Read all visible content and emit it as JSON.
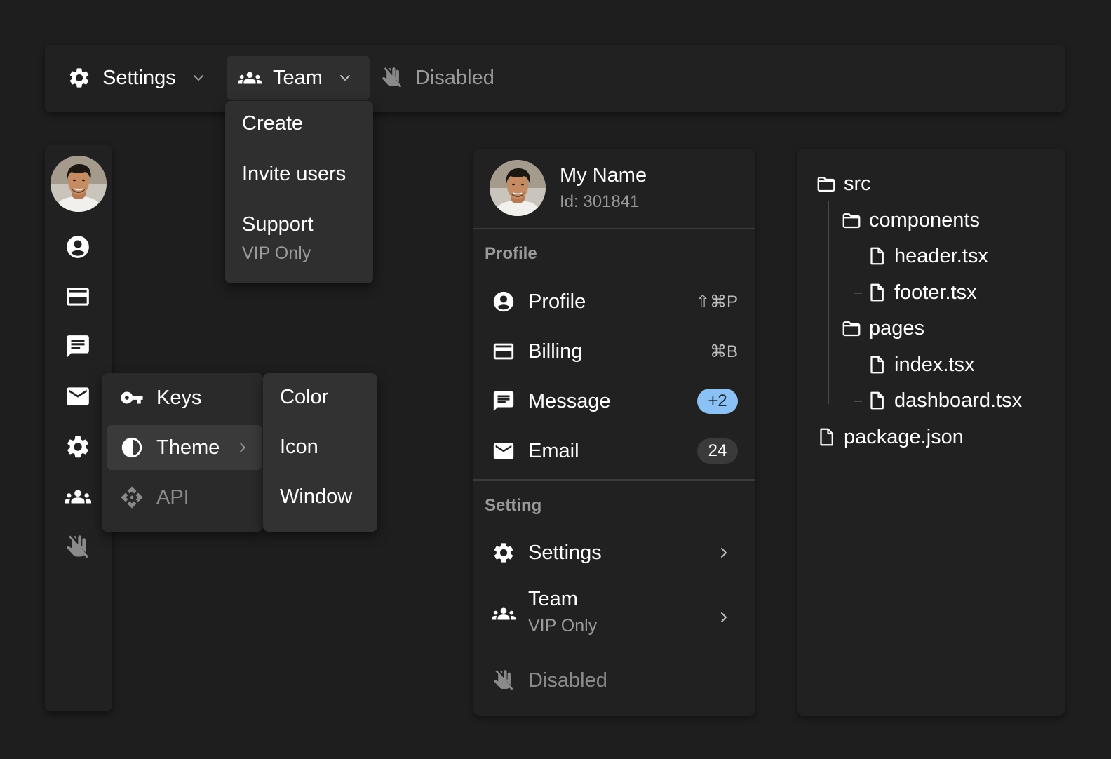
{
  "menubar": {
    "settings": {
      "label": "Settings",
      "icon": "gear-icon"
    },
    "team": {
      "label": "Team",
      "icon": "users-icon"
    },
    "disabled": {
      "label": "Disabled",
      "icon": "hand-icon"
    }
  },
  "team_dropdown": {
    "items": [
      {
        "label": "Create"
      },
      {
        "label": "Invite users"
      },
      {
        "label": "Support",
        "sub": "VIP Only"
      }
    ]
  },
  "rail": {
    "icons": [
      "user-circle-icon",
      "credit-card-icon",
      "message-icon",
      "mail-icon",
      "gear-icon",
      "users-icon",
      "hand-icon"
    ]
  },
  "flyout": {
    "items": [
      {
        "label": "Keys",
        "icon": "key-icon"
      },
      {
        "label": "Theme",
        "icon": "contrast-icon"
      },
      {
        "label": "API",
        "icon": "api-icon"
      }
    ]
  },
  "submenu": {
    "items": [
      {
        "label": "Color"
      },
      {
        "label": "Icon"
      },
      {
        "label": "Window"
      }
    ]
  },
  "profile_panel": {
    "name": "My Name",
    "id": "Id: 301841",
    "groups": [
      {
        "label": "Profile",
        "items": [
          {
            "label": "Profile",
            "shortcut": "⇧⌘P"
          },
          {
            "label": "Billing",
            "shortcut": "⌘B"
          },
          {
            "label": "Message",
            "badge": "+2"
          },
          {
            "label": "Email",
            "badge": "24"
          }
        ]
      },
      {
        "label": "Setting",
        "items": [
          {
            "label": "Settings"
          },
          {
            "label": "Team",
            "sub": "VIP Only"
          },
          {
            "label": "Disabled"
          }
        ]
      }
    ]
  },
  "file_tree": {
    "items": [
      {
        "label": "src",
        "type": "folder"
      },
      {
        "label": "components",
        "type": "folder"
      },
      {
        "label": "header.tsx",
        "type": "file"
      },
      {
        "label": "footer.tsx",
        "type": "file"
      },
      {
        "label": "pages",
        "type": "folder"
      },
      {
        "label": "index.tsx",
        "type": "file"
      },
      {
        "label": "dashboard.tsx",
        "type": "file"
      },
      {
        "label": "package.json",
        "type": "file"
      }
    ]
  },
  "colors": {
    "background": "#1e1e1f",
    "panel": "#212122",
    "badge_accent": "#8cc1f5",
    "badge_neutral": "#3a3a3b",
    "muted_text": "#9a9a9a"
  }
}
